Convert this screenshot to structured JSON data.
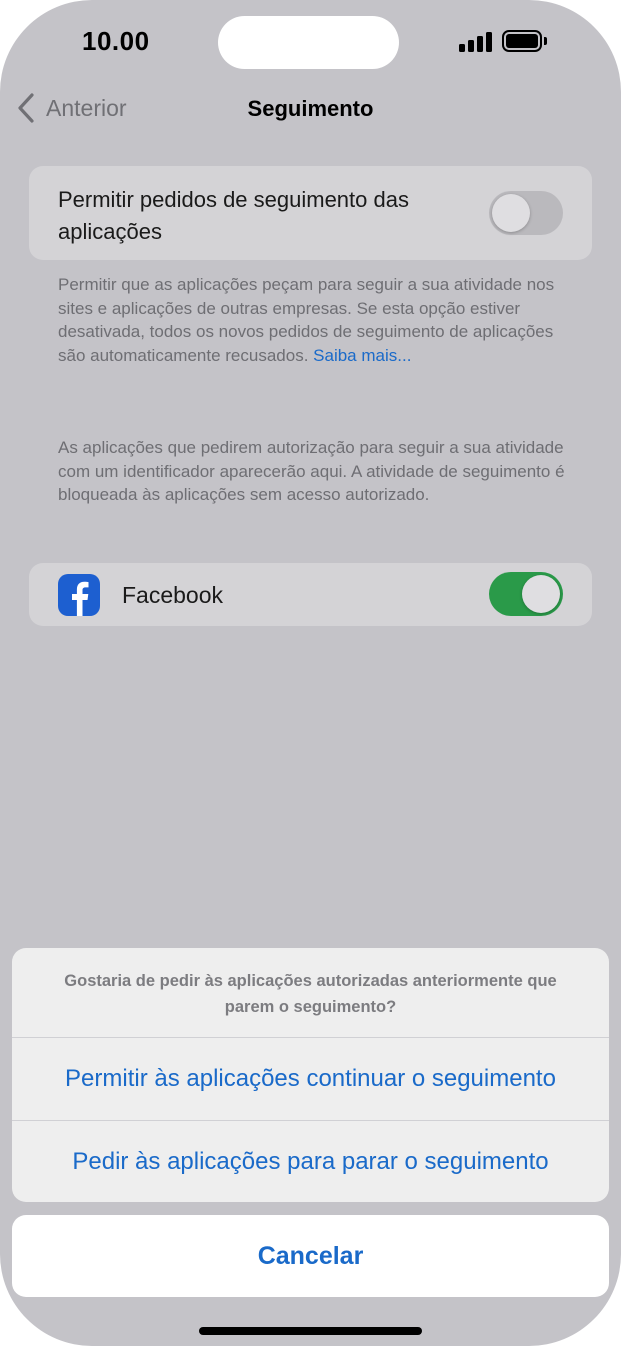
{
  "status_bar": {
    "time": "10.00"
  },
  "nav": {
    "back_label": "Anterior",
    "title": "Seguimento"
  },
  "tracking_setting": {
    "label": "Permitir pedidos de seguimento das aplicações",
    "enabled": false
  },
  "description": {
    "text": "Permitir que as aplicações peçam para seguir a sua atividade nos sites e aplicações de outras empresas. Se esta opção estiver desativada, todos os novos pedidos de seguimento de aplicações são automaticamente recusados. ",
    "link": "Saiba mais..."
  },
  "apps_note": "As aplicações que pedirem autorização para seguir a sua atividade com um identificador aparecerão aqui. A atividade de seguimento é bloqueada às aplicações sem acesso autorizado.",
  "apps": [
    {
      "name": "Facebook",
      "icon": "facebook-icon",
      "enabled": true
    }
  ],
  "action_sheet": {
    "message": "Gostaria de pedir às aplicações autorizadas anteriormente que parem o seguimento?",
    "options": [
      "Permitir às aplicações continuar o seguimento",
      "Pedir às aplicações para parar o seguimento"
    ],
    "cancel": "Cancelar"
  },
  "colors": {
    "accent": "#1a6ac9",
    "toggle_on": "#2a9a49",
    "facebook": "#1d5fd0"
  }
}
